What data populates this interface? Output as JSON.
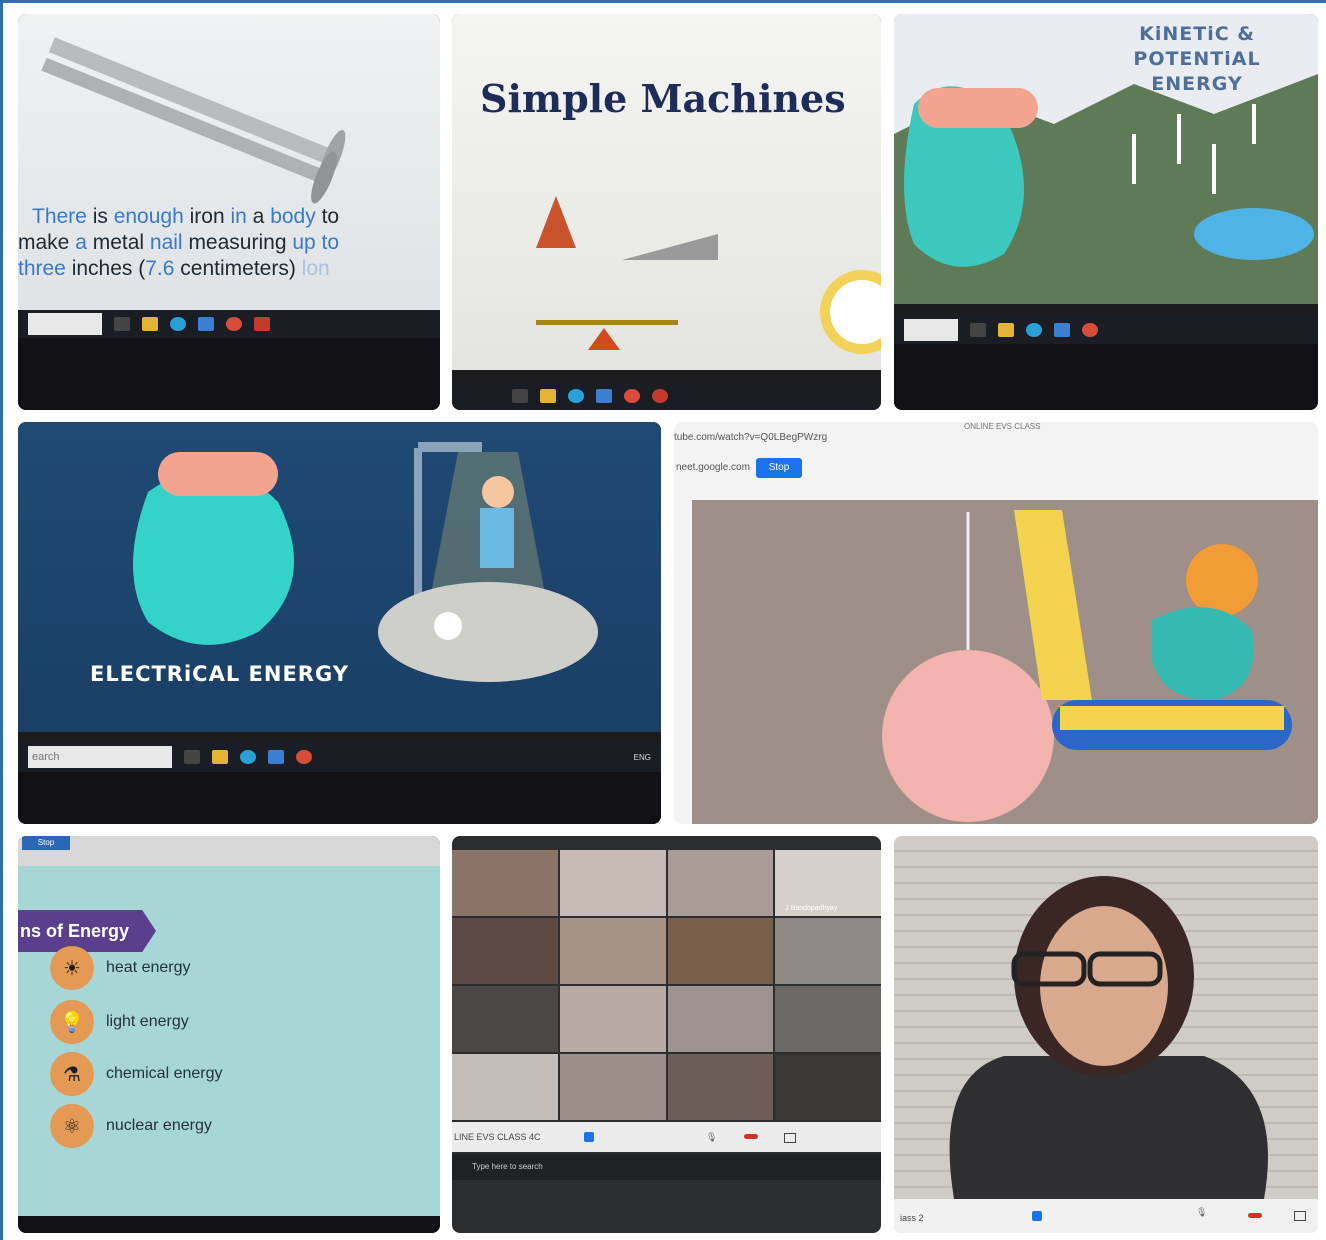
{
  "tiles": {
    "t1": {
      "fact_parts": [
        "There",
        " is ",
        "enough",
        " iron ",
        "in",
        " a ",
        "body",
        " to"
      ],
      "line2_parts": [
        "make ",
        "a",
        " metal ",
        "nail",
        " measuring ",
        "up to"
      ],
      "line3_parts": [
        "three",
        " inches (",
        "7.6",
        " centimeters) ",
        "lon"
      ]
    },
    "t2": {
      "title": "Simple Machines"
    },
    "t3": {
      "title_line1": "KiNETiC & POTENTiAL",
      "title_line2": "ENERGY"
    },
    "t4": {
      "title": "ELECTRiCAL ENERGY",
      "search": "earch",
      "tray": "ENG"
    },
    "t5": {
      "url": "tube.com/watch?v=Q0LBegPWzrg",
      "meet": "neet.google.com",
      "stop": "Stop",
      "tab": "ONLINE EVS CLASS"
    },
    "t6": {
      "stop": "Stop",
      "banner": "ns of Energy",
      "items": [
        "heat energy",
        "light energy",
        "chemical energy",
        "nuclear energy"
      ]
    },
    "t7": {
      "meeting": "LINE EVS CLASS 4C",
      "search": "Type here to search",
      "participant": "J Bandopadhyay"
    },
    "t8": {
      "meeting": "iass 2"
    }
  },
  "colors": {
    "frame": "#2f6db5",
    "highlight": "#3a79c9"
  }
}
